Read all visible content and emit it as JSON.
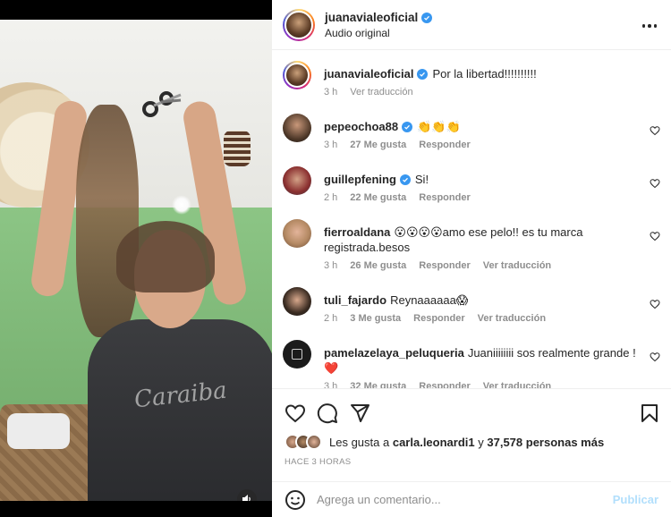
{
  "header": {
    "username": "juanavialeoficial",
    "subtitle": "Audio original"
  },
  "caption": {
    "username": "juanavialeoficial",
    "text": "Por la libertad!!!!!!!!!!",
    "time": "3 h",
    "translate": "Ver traducción"
  },
  "comments": [
    {
      "username": "pepeochoa88",
      "text": "👏👏👏",
      "time": "3 h",
      "likes": "27 Me gusta",
      "reply": "Responder",
      "translate": "",
      "verified": true
    },
    {
      "username": "guillepfening",
      "text": "Si!",
      "time": "2 h",
      "likes": "22 Me gusta",
      "reply": "Responder",
      "translate": "",
      "verified": true
    },
    {
      "username": "fierroaldana",
      "text": "😮😮😮😮amo ese pelo!! es tu marca registrada.besos",
      "time": "3 h",
      "likes": "26 Me gusta",
      "reply": "Responder",
      "translate": "Ver traducción",
      "verified": false
    },
    {
      "username": "tuli_fajardo",
      "text": "Reynaaaaaa😱",
      "time": "2 h",
      "likes": "3 Me gusta",
      "reply": "Responder",
      "translate": "Ver traducción",
      "verified": false
    },
    {
      "username": "pamelazelaya_peluqueria",
      "text": "Juaniiiiiiii sos realmente grande ! ❤️",
      "time": "3 h",
      "likes": "32 Me gusta",
      "reply": "Responder",
      "translate": "Ver traducción",
      "verified": false
    }
  ],
  "likes": {
    "prefix": "Les gusta a",
    "first_user": "carla.leonardi1",
    "conjunction": "y",
    "others": "37,578 personas más"
  },
  "timestamp": "HACE 3 HORAS",
  "add_comment": {
    "placeholder": "Agrega un comentario...",
    "post_label": "Publicar"
  },
  "media": {
    "shirt_text": "Caraiba"
  },
  "colors": {
    "verified": "#3897f0",
    "muted": "#8e8e8e",
    "post_disabled": "#b2dffc",
    "heart_red": "#ed4956"
  },
  "icons": [
    "more-icon",
    "heart-icon",
    "comment-icon",
    "share-icon",
    "save-icon",
    "emoji-icon",
    "mute-icon",
    "verified-icon"
  ]
}
